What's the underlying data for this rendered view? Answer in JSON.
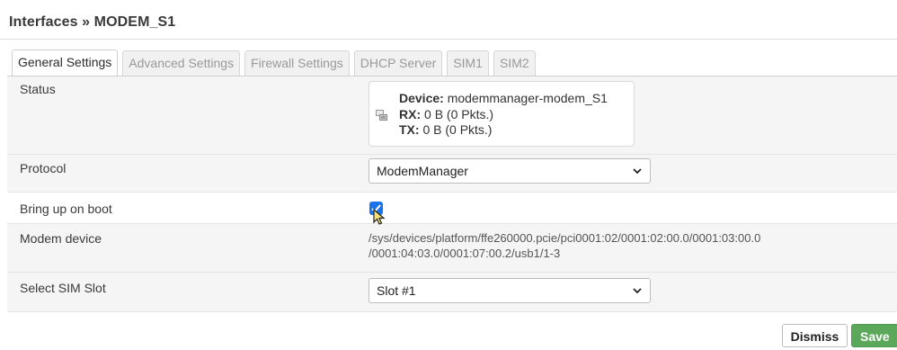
{
  "header": {
    "title": "Interfaces » MODEM_S1"
  },
  "tabs": [
    {
      "label": "General Settings",
      "active": true
    },
    {
      "label": "Advanced Settings",
      "active": false
    },
    {
      "label": "Firewall Settings",
      "active": false
    },
    {
      "label": "DHCP Server",
      "active": false
    },
    {
      "label": "SIM1",
      "active": false
    },
    {
      "label": "SIM2",
      "active": false
    }
  ],
  "status": {
    "label": "Status",
    "device_key": "Device:",
    "device_value": " modemmanager-modem_S1",
    "rx_key": "RX:",
    "rx_value": " 0 B (0 Pkts.)",
    "tx_key": "TX:",
    "tx_value": " 0 B (0 Pkts.)",
    "icon": "network-device-icon"
  },
  "protocol": {
    "label": "Protocol",
    "value": "ModemManager"
  },
  "boot": {
    "label": "Bring up on boot",
    "checked": true
  },
  "modem_device": {
    "label": "Modem device",
    "path_line1": "/sys/devices/platform/ffe260000.pcie/pci0001:02/0001:02:00.0/0001:03:00.0",
    "path_line2": "/0001:04:03.0/0001:07:00.2/usb1/1-3"
  },
  "sim_slot": {
    "label": "Select SIM Slot",
    "value": "Slot #1"
  },
  "buttons": {
    "dismiss": "Dismiss",
    "save": "Save"
  },
  "colors": {
    "accent_checkbox": "#1a73e8",
    "save_button": "#5ba85b"
  }
}
